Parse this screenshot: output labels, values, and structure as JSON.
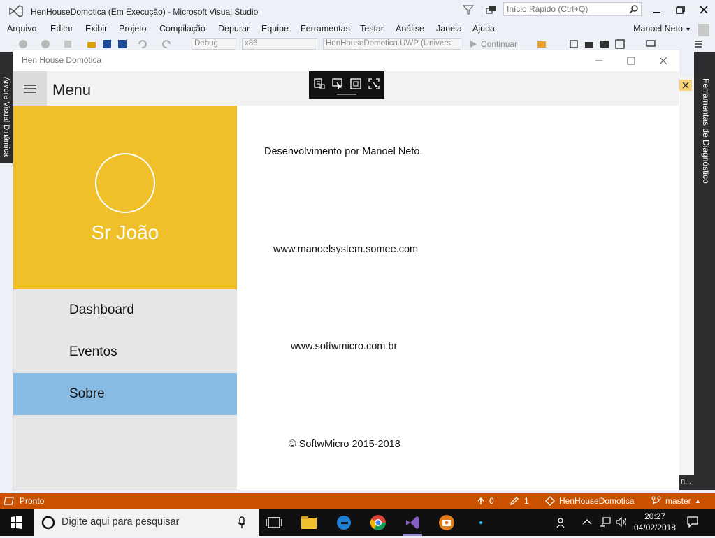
{
  "vs": {
    "title": "HenHouseDomotica (Em Execução) - Microsoft Visual Studio",
    "quick_launch_placeholder": "Início Rápido (Ctrl+Q)",
    "menu": [
      "Arquivo",
      "Editar",
      "Exibir",
      "Projeto",
      "Compilação",
      "Depurar",
      "Equipe",
      "Ferramentas",
      "Testar",
      "Análise",
      "Janela",
      "Ajuda"
    ],
    "user": "Manoel Neto",
    "toolbar": {
      "config": "Debug",
      "platform": "x86",
      "project": "HenHouseDomotica.UWP (Univers",
      "continue": "Continuar"
    },
    "right_tab": "Ferramentas de Diagnóstico",
    "left_tab": "Árvore Visual Dinâmica",
    "right_bottom": "n...",
    "status": {
      "ready": "Pronto",
      "push_count": "0",
      "pencil_count": "1",
      "repo": "HenHouseDomotica",
      "branch": "master"
    }
  },
  "app": {
    "window_title": "Hen House Domótica",
    "header_title": "Menu",
    "profile_name": "Sr João",
    "nav": [
      {
        "label": "Dashboard"
      },
      {
        "label": "Eventos"
      },
      {
        "label": "Sobre"
      }
    ],
    "content": {
      "dev": "Desenvolvimento por Manoel Neto.",
      "site1": "www.manoelsystem.somee.com",
      "site2": "www.softwmicro.com.br",
      "copyright": "© SoftwMicro 2015-2018"
    },
    "colors": {
      "profile_bg": "#efc02a",
      "selected_nav": "#89bce4",
      "status_bar": "#ca5100"
    }
  },
  "taskbar": {
    "search_placeholder": "Digite aqui para pesquisar",
    "time": "20:27",
    "date": "04/02/2018"
  }
}
